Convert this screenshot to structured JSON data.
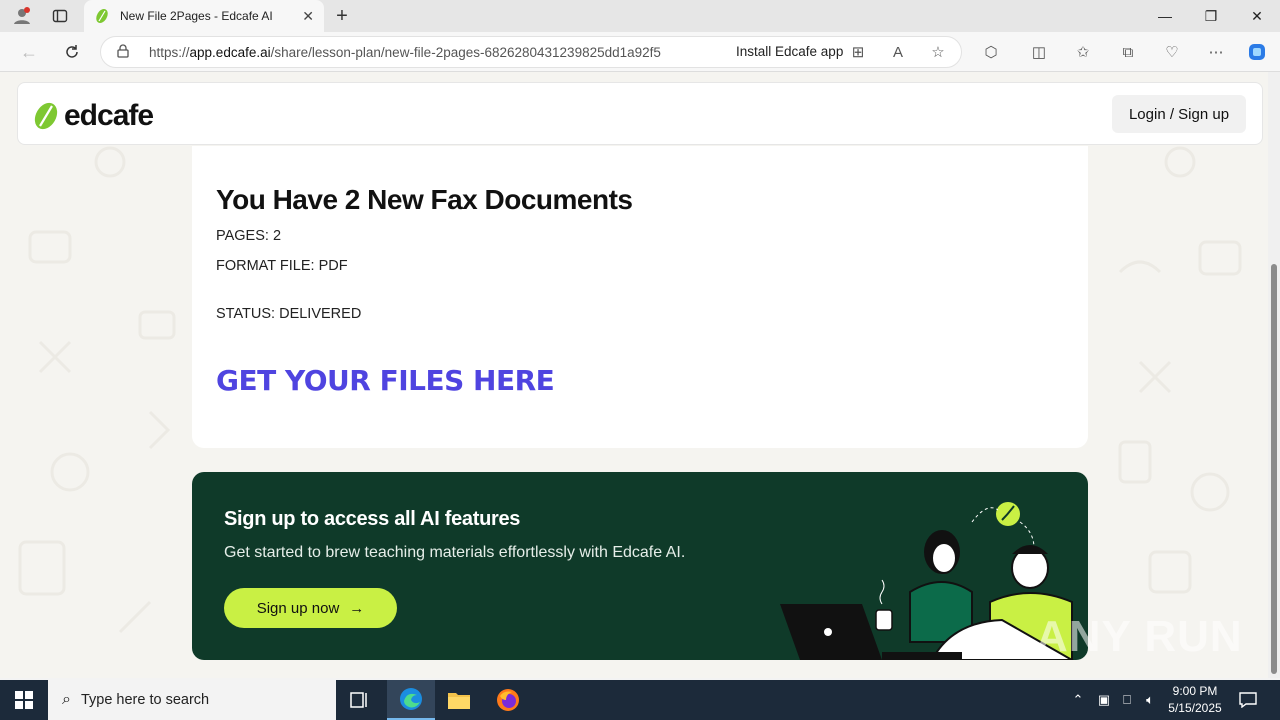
{
  "browser": {
    "tab_title": "New File 2Pages - Edcafe AI",
    "url_prefix": "https://",
    "url_host": "app.edcafe.ai",
    "url_path": "/share/lesson-plan/new-file-2pages-6826280431239825dd1a92f5",
    "install_label": "Install Edcafe app"
  },
  "site": {
    "logo_text": "edcafe",
    "login_label": "Login / Sign up"
  },
  "document": {
    "title": "You Have 2 New Fax Documents",
    "pages": "PAGES: 2",
    "format": "FORMAT FILE: PDF",
    "status": "STATUS: DELIVERED",
    "cta": "GET YOUR FILES HERE"
  },
  "promo": {
    "title": "Sign up to access all AI features",
    "subtitle": "Get started to brew teaching materials effortlessly with Edcafe AI.",
    "button_label": "Sign up now",
    "arrow": "→"
  },
  "watermark": "ANY RUN",
  "taskbar": {
    "search_placeholder": "Type here to search",
    "time": "9:00 PM",
    "date": "5/15/2025"
  },
  "colors": {
    "brand_green": "#7ec832",
    "promo_bg": "#0f3a29",
    "lime": "#c9f044",
    "cta_purple": "#4f44e0"
  }
}
